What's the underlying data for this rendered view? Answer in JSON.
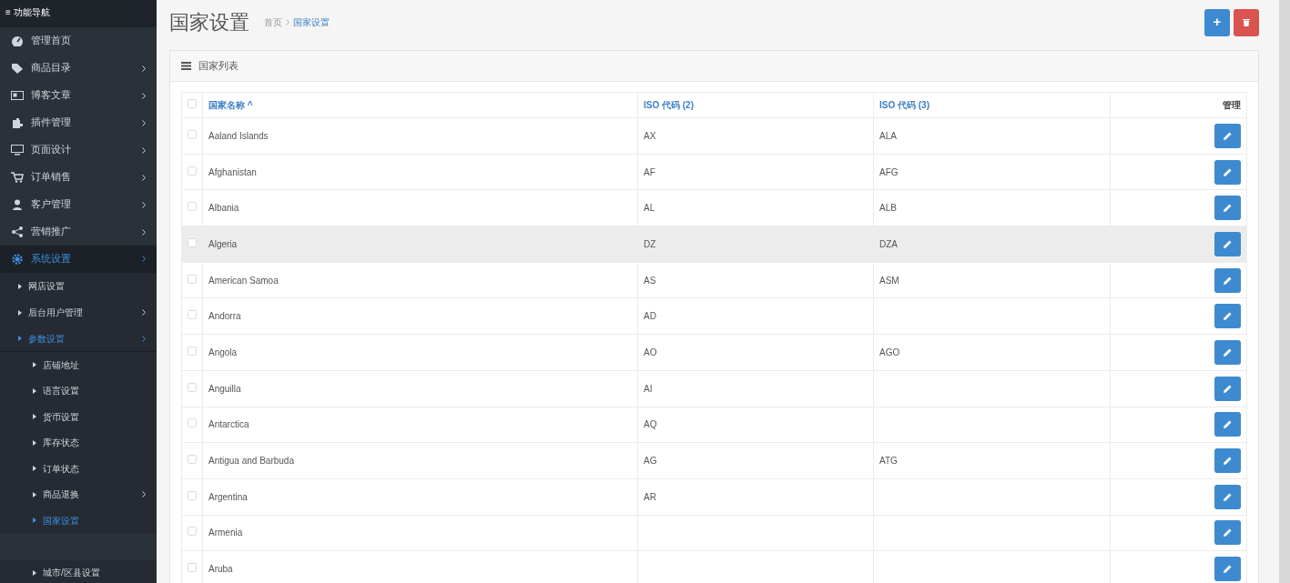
{
  "sidebar": {
    "title": "≡ 功能导航",
    "items": [
      {
        "label": "管理首页",
        "has_arrow": false,
        "selected": false
      },
      {
        "label": "商品目录",
        "has_arrow": true,
        "selected": false
      },
      {
        "label": "博客文章",
        "has_arrow": true,
        "selected": false
      },
      {
        "label": "插件管理",
        "has_arrow": true,
        "selected": false
      },
      {
        "label": "页面设计",
        "has_arrow": true,
        "selected": false
      },
      {
        "label": "订单销售",
        "has_arrow": true,
        "selected": false
      },
      {
        "label": "客户管理",
        "has_arrow": true,
        "selected": false
      },
      {
        "label": "营销推广",
        "has_arrow": true,
        "selected": false
      },
      {
        "label": "系统设置",
        "has_arrow": true,
        "selected": true,
        "expanded": true,
        "children": [
          {
            "label": "网店设置",
            "has_arrow": false,
            "selected": false
          },
          {
            "label": "后台用户管理",
            "has_arrow": true,
            "selected": false
          },
          {
            "label": "参数设置",
            "has_arrow": true,
            "selected": true,
            "expanded": true,
            "children": [
              {
                "label": "店铺地址",
                "has_arrow": false,
                "selected": false
              },
              {
                "label": "语言设置",
                "has_arrow": false,
                "selected": false
              },
              {
                "label": "货币设置",
                "has_arrow": false,
                "selected": false
              },
              {
                "label": "库存状态",
                "has_arrow": false,
                "selected": false
              },
              {
                "label": "订单状态",
                "has_arrow": false,
                "selected": false
              },
              {
                "label": "商品退换",
                "has_arrow": true,
                "selected": false
              },
              {
                "label": "国家设置",
                "has_arrow": false,
                "selected": true
              },
              {
                "kind": "obscured"
              },
              {
                "label": "城市/区县设置",
                "has_arrow": false,
                "selected": false
              }
            ]
          }
        ]
      }
    ]
  },
  "header": {
    "title": "国家设置",
    "breadcrumb": [
      {
        "label": "首页",
        "current": false
      },
      {
        "label": "国家设置",
        "current": true
      }
    ],
    "actions": [
      {
        "kind": "add",
        "label": "+"
      },
      {
        "kind": "delete"
      }
    ]
  },
  "panel": {
    "title": "国家列表"
  },
  "table": {
    "select_all_checked": false,
    "columns": [
      {
        "label": "国家名称 ^",
        "sortable": true
      },
      {
        "label": "ISO 代码 (2)",
        "sortable": true
      },
      {
        "label": "ISO 代码 (3)",
        "sortable": true
      },
      {
        "label": "管理",
        "sortable": false
      }
    ],
    "rows": [
      {
        "name": "Aaland Islands",
        "iso2": "AX",
        "iso3": "ALA",
        "checked": false,
        "highlighted": false
      },
      {
        "name": "Afghanistan",
        "iso2": "AF",
        "iso3": "AFG",
        "checked": false,
        "highlighted": false
      },
      {
        "name": "Albania",
        "iso2": "AL",
        "iso3": "ALB",
        "checked": false,
        "highlighted": false
      },
      {
        "name": "Algeria",
        "iso2": "DZ",
        "iso3": "DZA",
        "checked": false,
        "highlighted": true
      },
      {
        "name": "American Samoa",
        "iso2": "AS",
        "iso3": "ASM",
        "checked": false,
        "highlighted": false
      },
      {
        "name": "Andorra",
        "iso2": "AD",
        "checked": false,
        "highlighted": false
      },
      {
        "name": "Angola",
        "iso2": "AO",
        "iso3": "AGO",
        "checked": false,
        "highlighted": false
      },
      {
        "name": "Anguilla",
        "iso2": "AI",
        "checked": false,
        "highlighted": false
      },
      {
        "name": "Antarctica",
        "iso2": "AQ",
        "checked": false,
        "highlighted": false
      },
      {
        "name": "Antigua and Barbuda",
        "iso2": "AG",
        "iso3": "ATG",
        "checked": false,
        "highlighted": false
      },
      {
        "name": "Argentina",
        "iso2": "AR",
        "checked": false,
        "highlighted": false
      },
      {
        "name": "Armenia",
        "checked": false,
        "highlighted": false
      },
      {
        "name": "Aruba",
        "checked": false,
        "highlighted": false
      }
    ]
  }
}
